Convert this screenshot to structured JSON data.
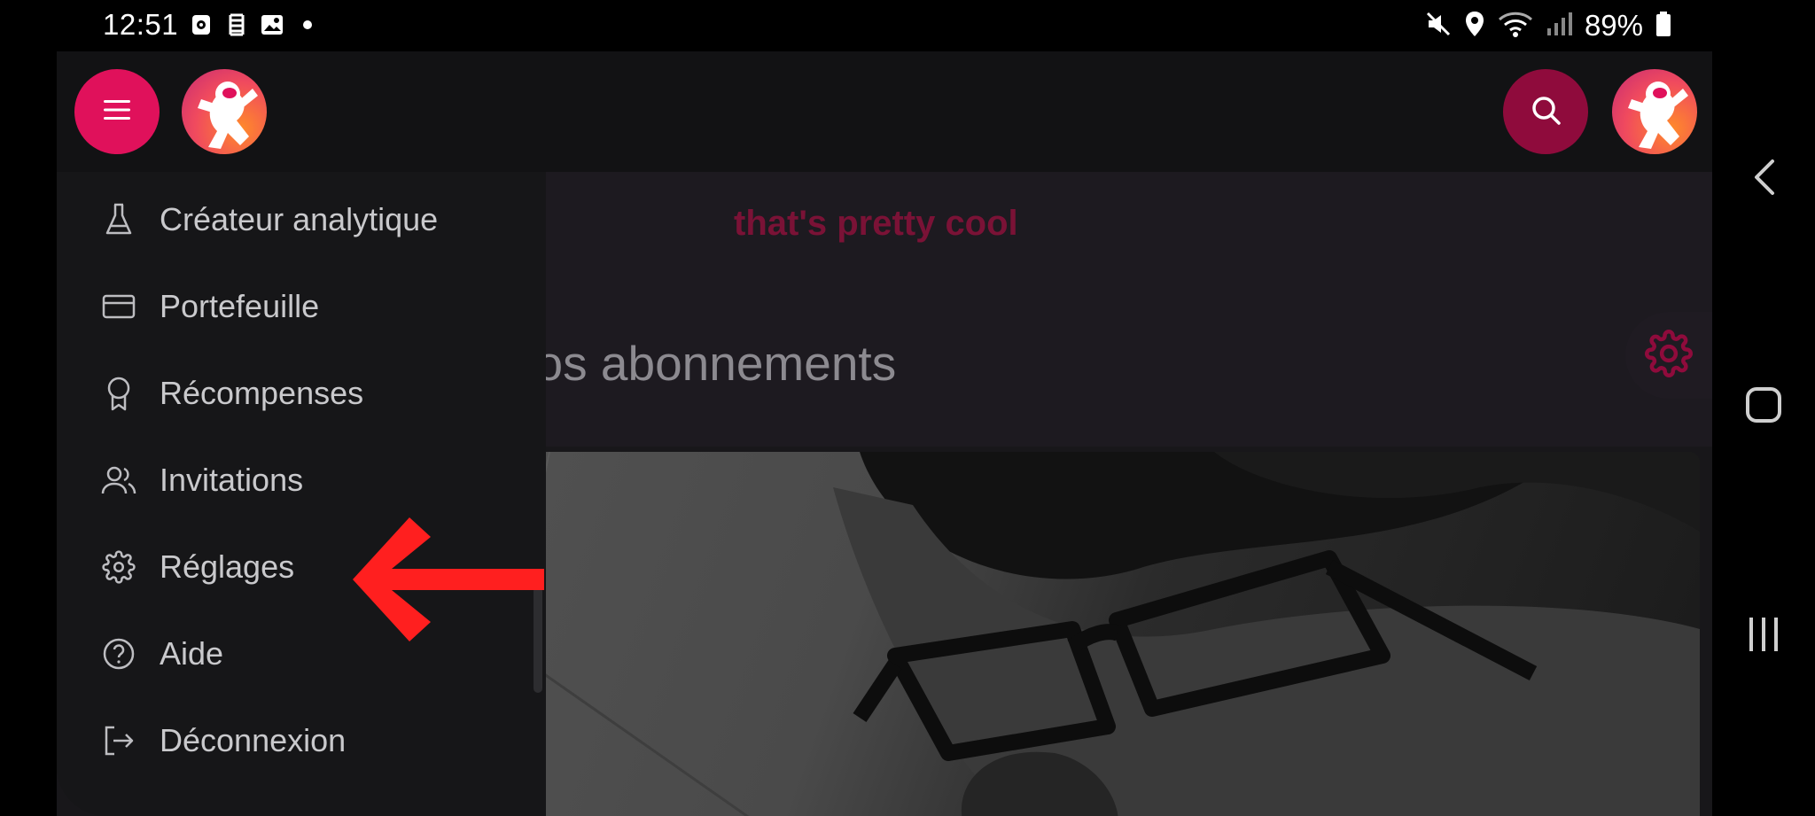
{
  "status_bar": {
    "time": "12:51",
    "battery": "89%",
    "left_icons": [
      "media-icon",
      "sim-icon",
      "image-icon",
      "dot-icon"
    ],
    "right_icons": [
      "mute-icon",
      "location-icon",
      "wifi-icon",
      "signal-icon",
      "battery-icon"
    ]
  },
  "header": {
    "menu_icon": "hamburger-icon",
    "search_icon": "search-icon",
    "accent_color": "#e0115b",
    "search_color": "#8f0b3c"
  },
  "main": {
    "banner_text": "that's pretty cool",
    "subscriptions_title": "t de vos abonnements"
  },
  "drawer": {
    "items": [
      {
        "label": "Créateur analytique",
        "icon": "flask-icon"
      },
      {
        "label": "Portefeuille",
        "icon": "card-icon"
      },
      {
        "label": "Récompenses",
        "icon": "badge-icon"
      },
      {
        "label": "Invitations",
        "icon": "users-icon"
      },
      {
        "label": "Réglages",
        "icon": "gear-icon"
      },
      {
        "label": "Aide",
        "icon": "help-icon"
      },
      {
        "label": "Déconnexion",
        "icon": "logout-icon"
      }
    ]
  },
  "nav": {
    "back_icon": "back-icon",
    "home_icon": "home-icon",
    "recents_icon": "recents-icon"
  }
}
